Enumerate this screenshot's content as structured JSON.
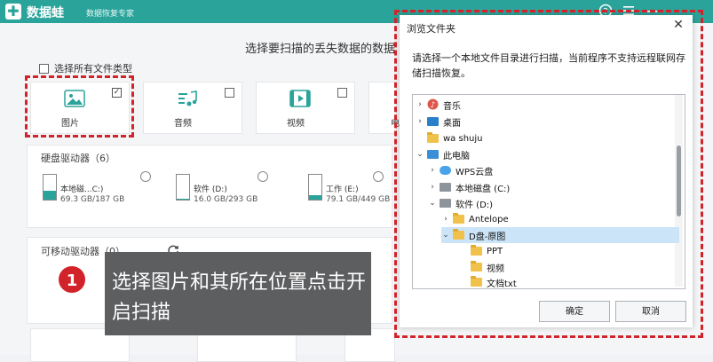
{
  "app": {
    "logo_glyph": "✚",
    "name": "数据蛙",
    "subtitle": "数据恢复专家",
    "icons": [
      "help-icon",
      "menu-icon",
      "minimize-icon",
      "close-icon"
    ]
  },
  "main": {
    "title": "选择要扫描的丢失数据的数据",
    "select_all_label": "选择所有文件类型",
    "file_types": [
      {
        "label": "图片",
        "checked": true,
        "icon": "image-icon"
      },
      {
        "label": "音频",
        "checked": false,
        "icon": "audio-icon"
      },
      {
        "label": "视频",
        "checked": false,
        "icon": "video-icon"
      },
      {
        "label": "电",
        "checked": false,
        "icon": "document-icon"
      }
    ],
    "hard_drives": {
      "title": "硬盘驱动器（6）",
      "drives": [
        {
          "name": "本地磁...C:)",
          "size": "69.3 GB/187 GB",
          "used_fraction": 0.37
        },
        {
          "name": "软件 (D:)",
          "size": "16.0 GB/293 GB",
          "used_fraction": 0.05
        },
        {
          "name": "工作 (E:)",
          "size": "79.1 GB/449 GB",
          "used_fraction": 0.18
        }
      ]
    },
    "removable": {
      "title": "可移动驱动器（0）"
    }
  },
  "callout": {
    "number": "1",
    "text": "选择图片和其所在位置点击开启扫描"
  },
  "dialog": {
    "title": "浏览文件夹",
    "close_glyph": "✕",
    "description": "请选择一个本地文件目录进行扫描，当前程序不支持远程联网存储扫描恢复。",
    "tree": [
      {
        "label": "音乐",
        "level": 0,
        "chevron": "›",
        "icon": "music-icon"
      },
      {
        "label": "桌面",
        "level": 0,
        "chevron": "›",
        "icon": "desktop-icon"
      },
      {
        "label": "wa shuju",
        "level": 0,
        "chevron": "",
        "icon": "folder-icon"
      },
      {
        "label": "此电脑",
        "level": 0,
        "chevron": "⌄",
        "icon": "computer-icon"
      },
      {
        "label": "WPS云盘",
        "level": 1,
        "chevron": "›",
        "icon": "cloud-icon"
      },
      {
        "label": "本地磁盘 (C:)",
        "level": 1,
        "chevron": "›",
        "icon": "drive-icon"
      },
      {
        "label": "软件 (D:)",
        "level": 1,
        "chevron": "⌄",
        "icon": "drive-icon"
      },
      {
        "label": "Antelope",
        "level": 2,
        "chevron": "›",
        "icon": "folder-icon"
      },
      {
        "label": "D盘-原图",
        "level": 2,
        "chevron": "⌄",
        "icon": "folder-icon",
        "selected": true
      },
      {
        "label": "PPT",
        "level": 3,
        "chevron": "",
        "icon": "folder-icon"
      },
      {
        "label": "视频",
        "level": 3,
        "chevron": "",
        "icon": "folder-icon"
      },
      {
        "label": "文档txt",
        "level": 3,
        "chevron": "",
        "icon": "folder-icon"
      }
    ],
    "ok_label": "确定",
    "cancel_label": "取消"
  },
  "colors": {
    "brand": "#2aa39a",
    "highlight_red": "#d2232a",
    "callout_bg": "#5d5e60"
  }
}
